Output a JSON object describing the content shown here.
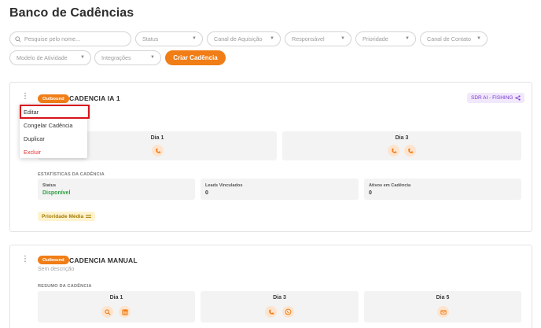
{
  "page": {
    "title": "Banco de Cadências"
  },
  "filters": {
    "search_placeholder": "Pesquise pelo nome...",
    "status": "Status",
    "canal_aquisicao": "Canal de Aquisição",
    "responsavel": "Responsável",
    "prioridade": "Prioridade",
    "canal_contato": "Canal de Contato",
    "modelo_atividade": "Modelo de Atividade",
    "integracoes": "Integrações",
    "create_label": "Criar Cadência"
  },
  "colors": {
    "accent": "#f07d16",
    "danger": "#e03131",
    "success": "#2ea043",
    "sdr_purple": "#7a3ad1"
  },
  "cadences": [
    {
      "badge": "Outbound",
      "title": "CADENCIA IA 1",
      "tag": "SDR AI - FISHING",
      "days": [
        {
          "label": "Dia 1",
          "icons": [
            "phone-icon"
          ]
        },
        {
          "label": "Dia 3",
          "icons": [
            "phone-icon",
            "phone-icon"
          ]
        }
      ],
      "stats_label": "ESTATÍSTICAS DA CADÊNCIA",
      "stats": [
        {
          "key": "Status",
          "value": "Disponível"
        },
        {
          "key": "Leads Vinculados",
          "value": "0"
        },
        {
          "key": "Ativos em Cadência",
          "value": "0"
        }
      ],
      "priority": "Prioridade Média"
    },
    {
      "badge": "Outbound",
      "title": "CADENCIA MANUAL",
      "description": "Sem descrição",
      "summary_label": "RESUMO DA CADÊNCIA",
      "days": [
        {
          "label": "Dia 1",
          "icons": [
            "search-icon",
            "linkedin-icon"
          ]
        },
        {
          "label": "Dia 3",
          "icons": [
            "phone-icon",
            "whatsapp-icon"
          ]
        },
        {
          "label": "Dia 5",
          "icons": [
            "mail-icon"
          ]
        }
      ]
    }
  ],
  "context_menu": {
    "items": [
      {
        "label": "Editar"
      },
      {
        "label": "Congelar Cadência"
      },
      {
        "label": "Duplicar"
      },
      {
        "label": "Excluir"
      }
    ]
  }
}
